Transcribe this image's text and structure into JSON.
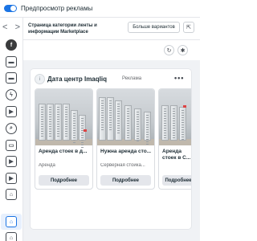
{
  "topbar": {
    "title": "Предпросмотр рекламы",
    "toggle_on": true,
    "accent": "#1b74e4"
  },
  "sidebar": {
    "nav_back": "<",
    "nav_forward": ">",
    "items": [
      {
        "icon": "facebook-icon",
        "glyph": "f"
      },
      {
        "icon": "feed-icon",
        "glyph": "▬"
      },
      {
        "icon": "marketplace-icon",
        "glyph": "▬"
      },
      {
        "icon": "lightning-icon",
        "glyph": "ϟ"
      },
      {
        "icon": "video-icon",
        "glyph": "▶"
      },
      {
        "icon": "search-icon",
        "glyph": "⌕"
      },
      {
        "icon": "stories-icon",
        "glyph": "▭"
      },
      {
        "icon": "reels-icon",
        "glyph": "▶"
      },
      {
        "icon": "play-icon",
        "glyph": "▶"
      },
      {
        "icon": "shop-icon",
        "glyph": "⌂"
      },
      {
        "icon": "marketplace-category-icon",
        "glyph": "⌂"
      },
      {
        "icon": "store-icon",
        "glyph": "⌂"
      },
      {
        "icon": "store-alt-icon",
        "glyph": "⌂"
      }
    ]
  },
  "header": {
    "placement": "Страница категории ленты и информации Marketplace",
    "more_button": "Больше вариантов",
    "external_icon": "external-link-icon"
  },
  "tools": {
    "refresh_icon": "refresh-icon",
    "bug_icon": "bug-icon"
  },
  "ad": {
    "avatar_initial": "i",
    "page_name": "Дата центр Imaqliq",
    "sponsored": "Реклама",
    "menu": "•••",
    "items": [
      {
        "title": "Аренда стоек в д...",
        "subtitle": "Аренда",
        "cta": "Подробнее"
      },
      {
        "title": "Нужна аренда сто...",
        "subtitle": "Серверная стойка...",
        "cta": "Подробнее"
      },
      {
        "title": "Аренда стоек в С...",
        "subtitle": "",
        "cta": "Подробнее"
      }
    ]
  }
}
